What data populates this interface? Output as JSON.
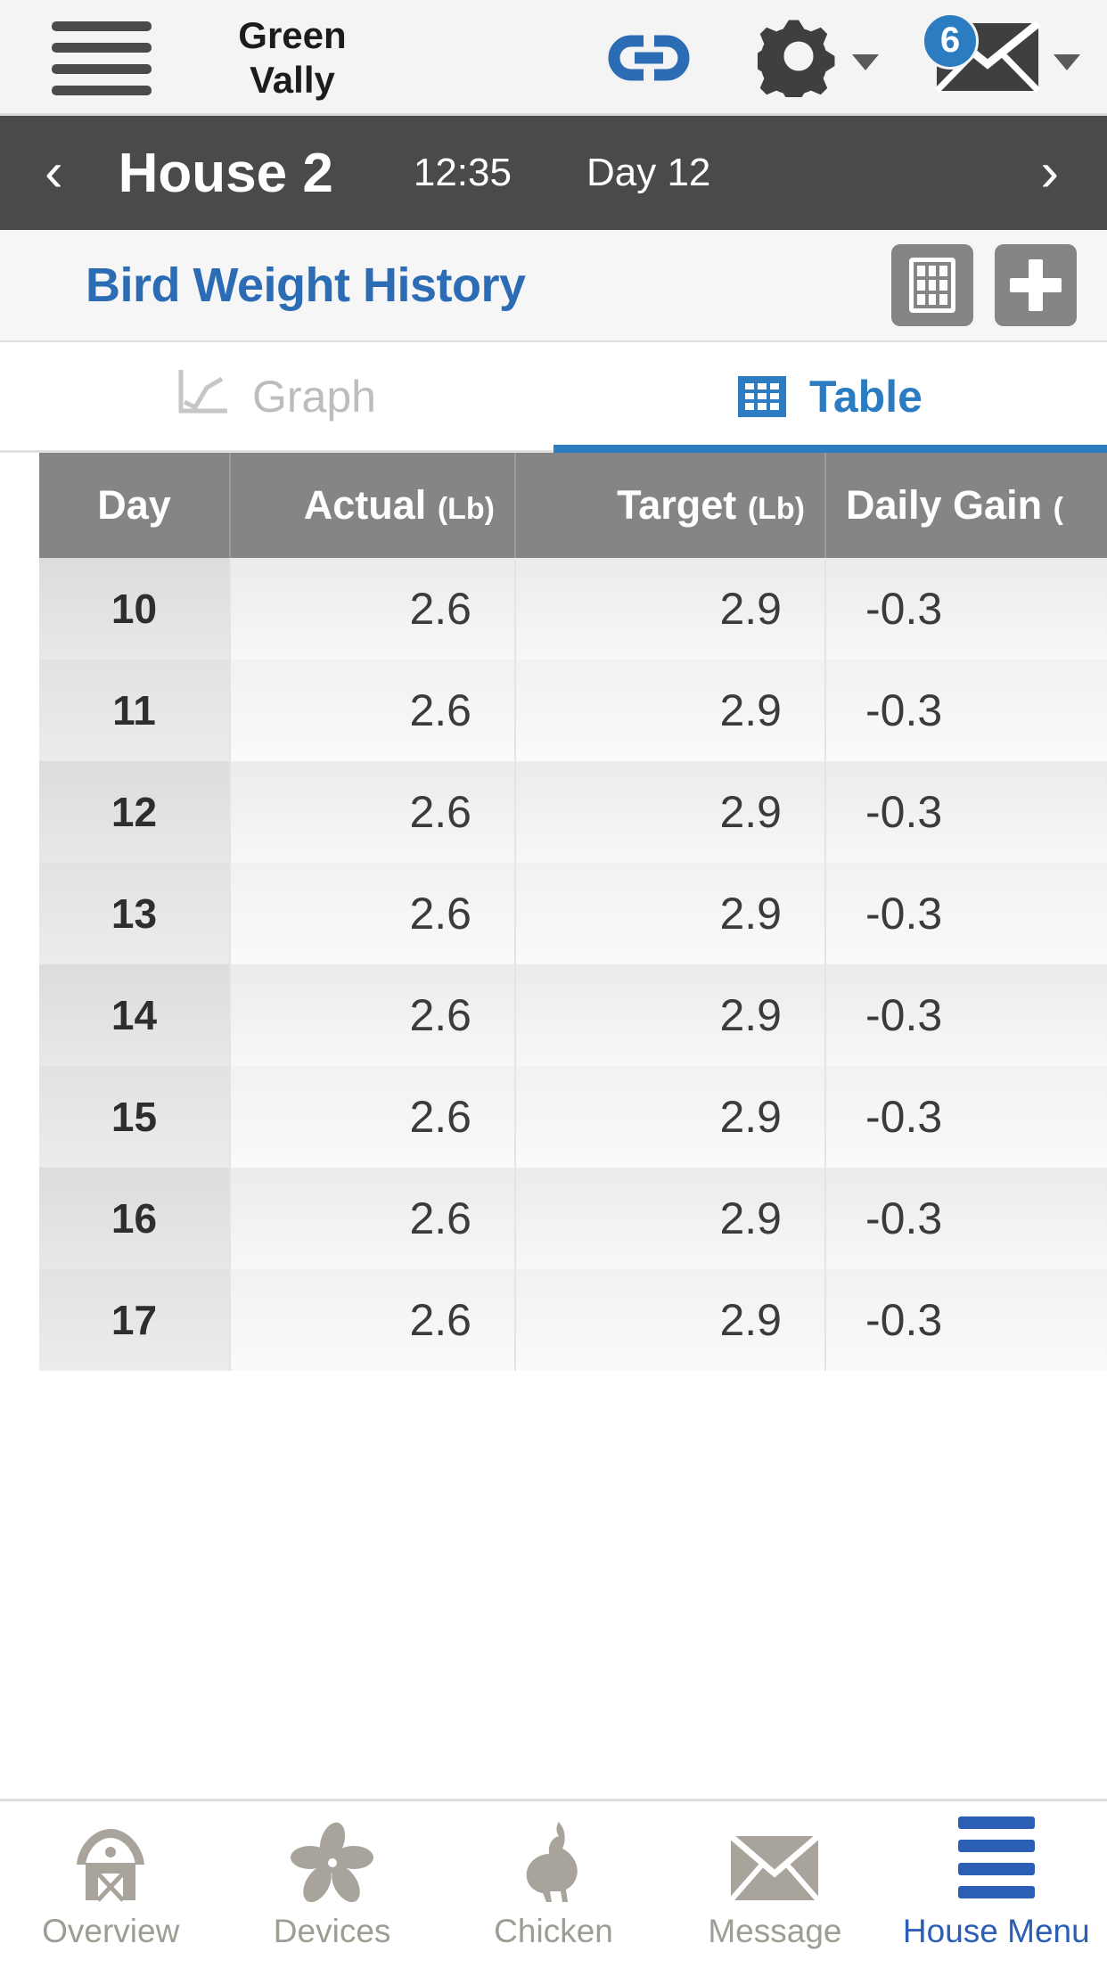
{
  "appbar": {
    "menu_icon": "hamburger-menu-icon",
    "brand_line1": "Green",
    "brand_line2": "Vally",
    "link_icon": "chain-link-icon",
    "gear_icon": "gear-icon",
    "mail_icon": "envelope-icon",
    "mail_badge": "6",
    "accent_blue": "#2b7cc0"
  },
  "housebar": {
    "prev_label": "‹",
    "title": "House 2",
    "time": "12:35",
    "day": "Day 12",
    "next_label": "›",
    "background": "#4a4a4a"
  },
  "panel": {
    "title": "Bird Weight History",
    "title_color": "#2b6cb5",
    "grid_button_icon": "table-grid-icon",
    "add_button_icon": "plus-icon"
  },
  "tabs": [
    {
      "label": "Graph",
      "icon": "line-chart-icon",
      "active": false
    },
    {
      "label": "Table",
      "icon": "table-grid-icon",
      "active": true
    }
  ],
  "table": {
    "headers": [
      {
        "label": "Day",
        "unit": ""
      },
      {
        "label": "Actual",
        "unit": "(Lb)"
      },
      {
        "label": "Target",
        "unit": "(Lb)"
      },
      {
        "label": "Daily Gain",
        "unit": "("
      }
    ],
    "rows": [
      {
        "day": "10",
        "actual": "2.6",
        "target": "2.9",
        "gain": "-0.3"
      },
      {
        "day": "11",
        "actual": "2.6",
        "target": "2.9",
        "gain": "-0.3"
      },
      {
        "day": "12",
        "actual": "2.6",
        "target": "2.9",
        "gain": "-0.3"
      },
      {
        "day": "13",
        "actual": "2.6",
        "target": "2.9",
        "gain": "-0.3"
      },
      {
        "day": "14",
        "actual": "2.6",
        "target": "2.9",
        "gain": "-0.3"
      },
      {
        "day": "15",
        "actual": "2.6",
        "target": "2.9",
        "gain": "-0.3"
      },
      {
        "day": "16",
        "actual": "2.6",
        "target": "2.9",
        "gain": "-0.3"
      },
      {
        "day": "17",
        "actual": "2.6",
        "target": "2.9",
        "gain": "-0.3"
      }
    ]
  },
  "bottomnav": [
    {
      "label": "Overview",
      "icon": "barn-icon",
      "active": false
    },
    {
      "label": "Devices",
      "icon": "fan-icon",
      "active": false
    },
    {
      "label": "Chicken",
      "icon": "chicken-icon",
      "active": false
    },
    {
      "label": "Message",
      "icon": "envelope-icon",
      "active": false
    },
    {
      "label": "House Menu",
      "icon": "hamburger-menu-icon",
      "active": true
    }
  ]
}
